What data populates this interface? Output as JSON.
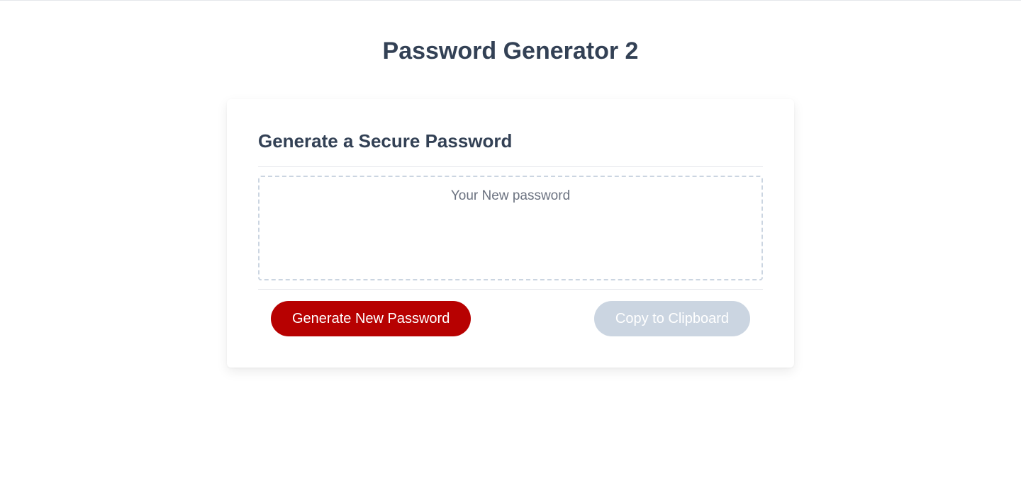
{
  "page": {
    "title": "Password Generator 2"
  },
  "card": {
    "heading": "Generate a Secure Password",
    "password_placeholder": "Your New password"
  },
  "buttons": {
    "generate": "Generate New Password",
    "copy": "Copy to Clipboard"
  },
  "colors": {
    "primary": "#b70101",
    "secondary": "#cbd5e1",
    "text_heading": "#334155",
    "text_muted": "#6b7280"
  }
}
